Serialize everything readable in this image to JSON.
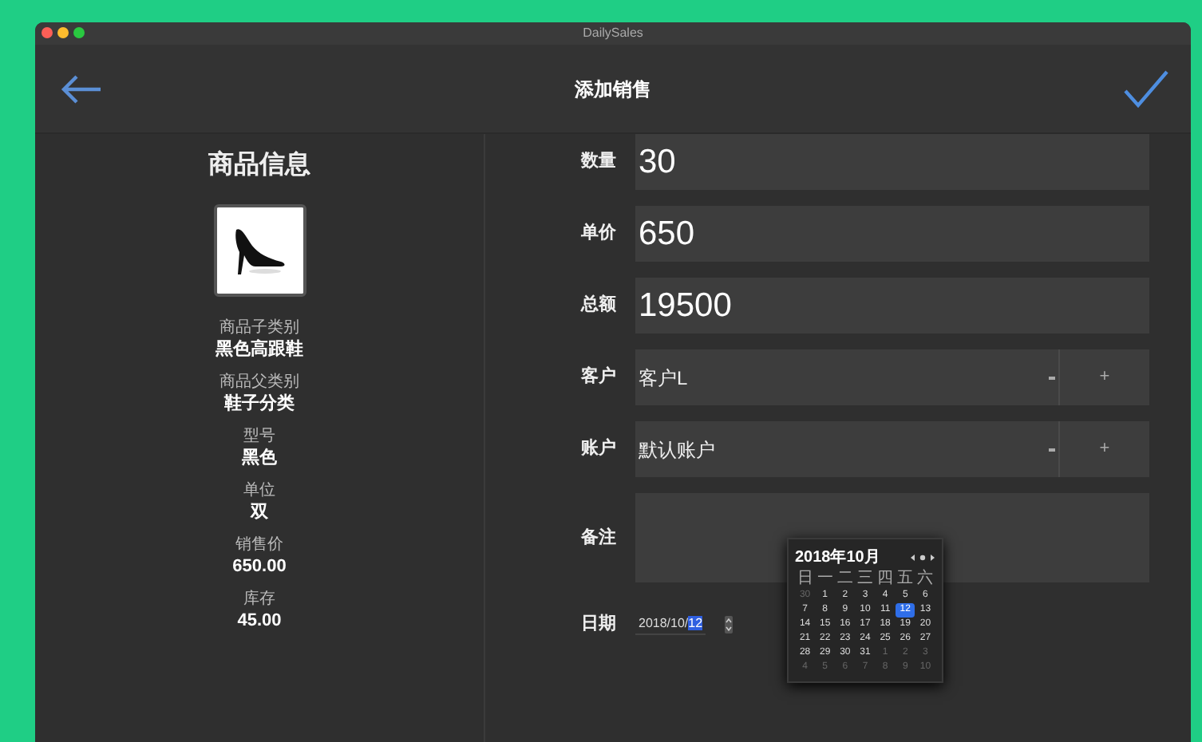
{
  "window": {
    "title": "DailySales"
  },
  "toolbar": {
    "title": "添加销售"
  },
  "product": {
    "title": "商品信息",
    "fields": [
      {
        "label": "商品子类别",
        "value": "黑色高跟鞋"
      },
      {
        "label": "商品父类别",
        "value": "鞋子分类"
      },
      {
        "label": "型号",
        "value": "黑色"
      },
      {
        "label": "单位",
        "value": "双"
      },
      {
        "label": "销售价",
        "value": "650.00"
      },
      {
        "label": "库存",
        "value": "45.00"
      }
    ]
  },
  "form": [
    {
      "kind": "text",
      "label": "数量",
      "value": "30"
    },
    {
      "kind": "text",
      "label": "单价",
      "value": "650"
    },
    {
      "kind": "text",
      "label": "总额",
      "value": "19500"
    },
    {
      "kind": "select",
      "label": "客户",
      "value": "客户L",
      "add": "+"
    },
    {
      "kind": "select",
      "label": "账户",
      "value": "默认账户",
      "add": "+"
    },
    {
      "kind": "textarea",
      "label": "备注"
    }
  ],
  "date": {
    "label": "日期",
    "value": "2018/10/",
    "selected_part": "12"
  },
  "calendar": {
    "title": "2018年10月",
    "weekdays": [
      "日",
      "一",
      "二",
      "三",
      "四",
      "五",
      "六"
    ],
    "days": [
      {
        "d": "30",
        "outside": true,
        "selected": false
      },
      {
        "d": "1",
        "outside": false,
        "selected": false
      },
      {
        "d": "2",
        "outside": false,
        "selected": false
      },
      {
        "d": "3",
        "outside": false,
        "selected": false
      },
      {
        "d": "4",
        "outside": false,
        "selected": false
      },
      {
        "d": "5",
        "outside": false,
        "selected": false
      },
      {
        "d": "6",
        "outside": false,
        "selected": false
      },
      {
        "d": "7",
        "outside": false,
        "selected": false
      },
      {
        "d": "8",
        "outside": false,
        "selected": false
      },
      {
        "d": "9",
        "outside": false,
        "selected": false
      },
      {
        "d": "10",
        "outside": false,
        "selected": false
      },
      {
        "d": "11",
        "outside": false,
        "selected": false
      },
      {
        "d": "12",
        "outside": false,
        "selected": true
      },
      {
        "d": "13",
        "outside": false,
        "selected": false
      },
      {
        "d": "14",
        "outside": false,
        "selected": false
      },
      {
        "d": "15",
        "outside": false,
        "selected": false
      },
      {
        "d": "16",
        "outside": false,
        "selected": false
      },
      {
        "d": "17",
        "outside": false,
        "selected": false
      },
      {
        "d": "18",
        "outside": false,
        "selected": false
      },
      {
        "d": "19",
        "outside": false,
        "selected": false
      },
      {
        "d": "20",
        "outside": false,
        "selected": false
      },
      {
        "d": "21",
        "outside": false,
        "selected": false
      },
      {
        "d": "22",
        "outside": false,
        "selected": false
      },
      {
        "d": "23",
        "outside": false,
        "selected": false
      },
      {
        "d": "24",
        "outside": false,
        "selected": false
      },
      {
        "d": "25",
        "outside": false,
        "selected": false
      },
      {
        "d": "26",
        "outside": false,
        "selected": false
      },
      {
        "d": "27",
        "outside": false,
        "selected": false
      },
      {
        "d": "28",
        "outside": false,
        "selected": false
      },
      {
        "d": "29",
        "outside": false,
        "selected": false
      },
      {
        "d": "30",
        "outside": false,
        "selected": false
      },
      {
        "d": "31",
        "outside": false,
        "selected": false
      },
      {
        "d": "1",
        "outside": true,
        "selected": false
      },
      {
        "d": "2",
        "outside": true,
        "selected": false
      },
      {
        "d": "3",
        "outside": true,
        "selected": false
      },
      {
        "d": "4",
        "outside": true,
        "selected": false
      },
      {
        "d": "5",
        "outside": true,
        "selected": false
      },
      {
        "d": "6",
        "outside": true,
        "selected": false
      },
      {
        "d": "7",
        "outside": true,
        "selected": false
      },
      {
        "d": "8",
        "outside": true,
        "selected": false
      },
      {
        "d": "9",
        "outside": true,
        "selected": false
      },
      {
        "d": "10",
        "outside": true,
        "selected": false
      }
    ]
  }
}
